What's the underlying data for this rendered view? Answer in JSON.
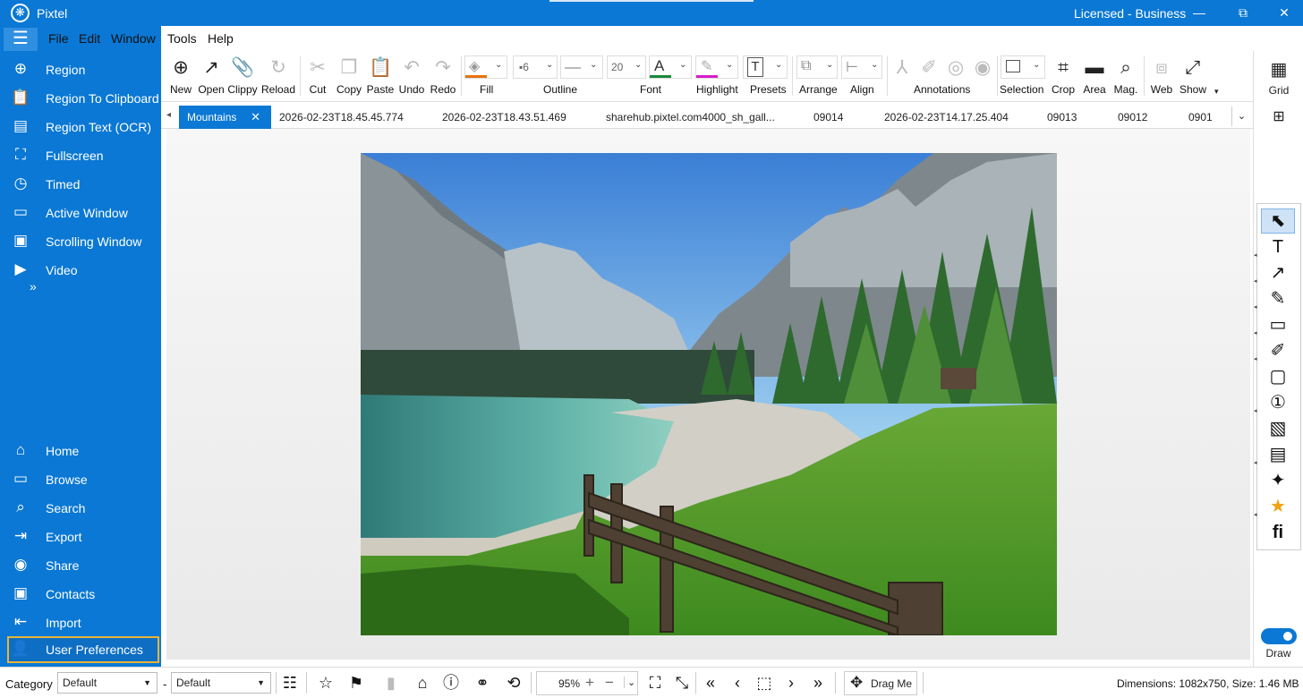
{
  "window": {
    "title": "Pixtel",
    "license": "Licensed - Business",
    "minimize": "—",
    "maximize": "⧉",
    "close": "✕"
  },
  "menu": [
    "File",
    "Edit",
    "Window",
    "Tools",
    "Help"
  ],
  "sidebar": {
    "top_items": [
      {
        "label": "Region",
        "icon": "crosshair-icon"
      },
      {
        "label": "Region To Clipboard",
        "icon": "clipboard-icon"
      },
      {
        "label": "Region Text (OCR)",
        "icon": "text-document-icon"
      },
      {
        "label": "Fullscreen",
        "icon": "fullscreen-icon"
      },
      {
        "label": "Timed",
        "icon": "timer-icon"
      },
      {
        "label": "Active Window",
        "icon": "window-icon"
      },
      {
        "label": "Scrolling Window",
        "icon": "scrolling-window-icon"
      },
      {
        "label": "Video",
        "icon": "video-icon"
      }
    ],
    "more": "»",
    "bottom_items": [
      {
        "label": "Home",
        "icon": "home-icon"
      },
      {
        "label": "Browse",
        "icon": "folder-icon"
      },
      {
        "label": "Search",
        "icon": "search-icon"
      },
      {
        "label": "Export",
        "icon": "export-icon"
      },
      {
        "label": "Share",
        "icon": "share-icon"
      },
      {
        "label": "Contacts",
        "icon": "contacts-icon"
      },
      {
        "label": "Import",
        "icon": "import-icon"
      },
      {
        "label": "User Preferences",
        "icon": "user-icon",
        "selected": true
      }
    ]
  },
  "toolbar": {
    "new": "New",
    "open": "Open",
    "clippy": "Clippy",
    "reload": "Reload",
    "cut": "Cut",
    "copy": "Copy",
    "paste": "Paste",
    "undo": "Undo",
    "redo": "Redo",
    "fill": "Fill",
    "outline": "Outline",
    "outline_size": "6",
    "font": "Font",
    "font_size": "20",
    "highlight": "Highlight",
    "presets": "Presets",
    "arrange": "Arrange",
    "align": "Align",
    "annotations": "Annotations",
    "selection": "Selection",
    "crop": "Crop",
    "area": "Area",
    "mag": "Mag.",
    "web": "Web",
    "show": "Show",
    "grid": "Grid",
    "fill_color": "#e8730f",
    "font_color": "#1a8a3a",
    "highlight_color": "#d61ec8"
  },
  "tabs": [
    {
      "label": "Mountains",
      "active": true
    },
    {
      "label": "2026-02-23T18.45.45.774"
    },
    {
      "label": "2026-02-23T18.43.51.469"
    },
    {
      "label": "sharehub.pixtel.com4000_sh_gall..."
    },
    {
      "label": "09014"
    },
    {
      "label": "2026-02-23T14.17.25.404"
    },
    {
      "label": "09013"
    },
    {
      "label": "09012"
    },
    {
      "label": "0901"
    }
  ],
  "drawing_panel": {
    "tools": [
      "select-arrow-icon",
      "text-icon",
      "arrow-icon",
      "pen-icon",
      "rectangle-icon",
      "marker-icon",
      "note-icon",
      "step-number-icon",
      "image-icon",
      "table-icon",
      "magic-icon",
      "star-icon",
      "font-icon"
    ],
    "draw_label": "Draw",
    "draw_enabled": true
  },
  "status": {
    "category_label": "Category",
    "category_value": "Default",
    "dash": "-",
    "subcategory_value": "Default",
    "zoom": "95%",
    "drag_me": "Drag Me",
    "dimensions": "Dimensions: 1082x750, Size: 1.46 MB"
  }
}
